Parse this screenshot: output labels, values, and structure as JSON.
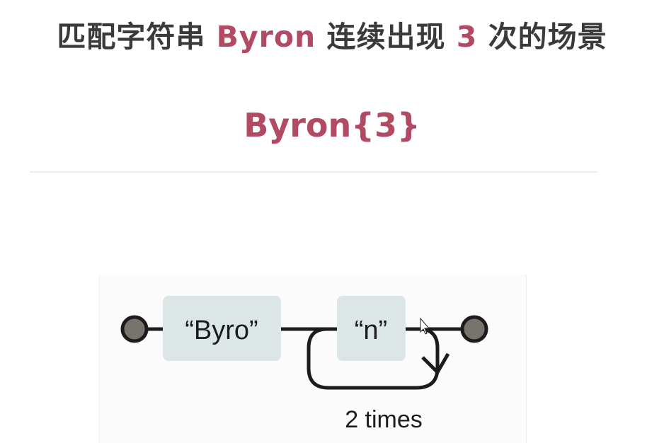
{
  "title": {
    "prefix": "匹配字符串 ",
    "keyword": "Byron",
    "middle": " 连续出现 ",
    "count": "3",
    "suffix": " 次的场景"
  },
  "pattern": "Byron{3}",
  "diagram": {
    "nodes": [
      {
        "label": "“Byro”"
      },
      {
        "label": "“n”"
      }
    ],
    "loop_label": "2 times",
    "colors": {
      "box": "#dde6e6",
      "line": "#1c1c1c",
      "terminal": "#77746d"
    }
  }
}
